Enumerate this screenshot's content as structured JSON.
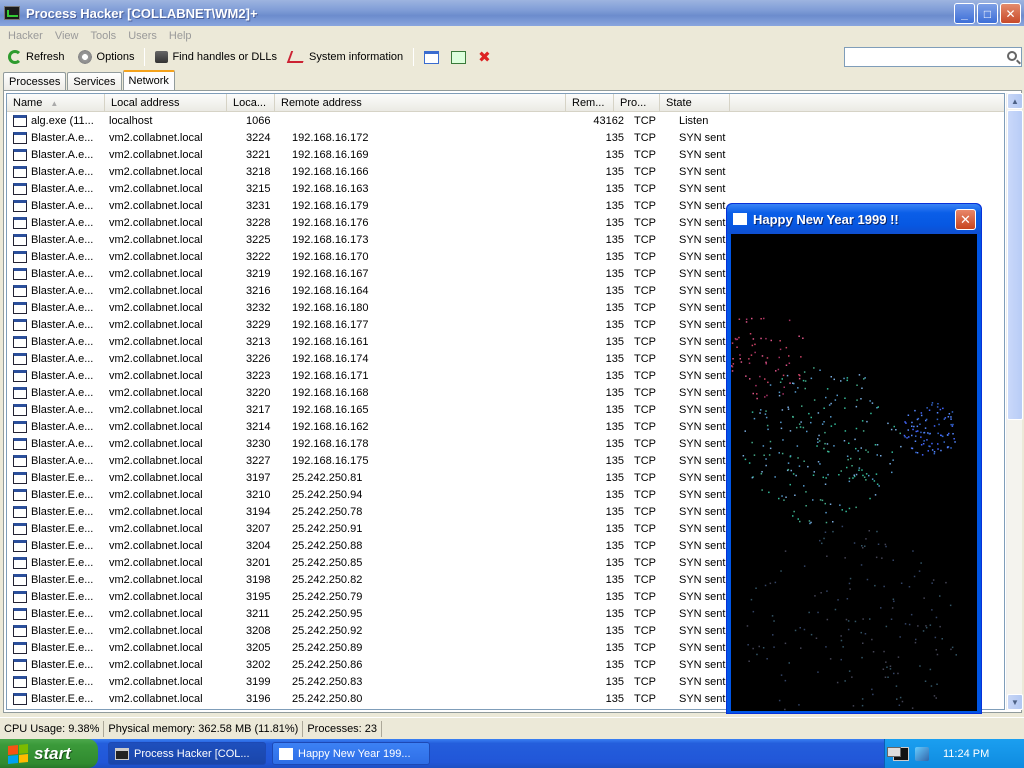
{
  "window": {
    "title": "Process Hacker [COLLABNET\\WM2]+"
  },
  "menu": [
    "Hacker",
    "View",
    "Tools",
    "Users",
    "Help"
  ],
  "toolbar": {
    "refresh": "Refresh",
    "options": "Options",
    "find_handles": "Find handles or DLLs",
    "system_information": "System information"
  },
  "search": {
    "placeholder": ""
  },
  "tabs": [
    "Processes",
    "Services",
    "Network"
  ],
  "active_tab": "Network",
  "columns": [
    "Name",
    "Local address",
    "Loca...",
    "Remote address",
    "Rem...",
    "Pro...",
    "State"
  ],
  "rows": [
    [
      "alg.exe (11...",
      "localhost",
      "1066",
      "",
      "43162",
      "TCP",
      "Listen"
    ],
    [
      "Blaster.A.e...",
      "vm2.collabnet.local",
      "3224",
      "192.168.16.172",
      "135",
      "TCP",
      "SYN sent"
    ],
    [
      "Blaster.A.e...",
      "vm2.collabnet.local",
      "3221",
      "192.168.16.169",
      "135",
      "TCP",
      "SYN sent"
    ],
    [
      "Blaster.A.e...",
      "vm2.collabnet.local",
      "3218",
      "192.168.16.166",
      "135",
      "TCP",
      "SYN sent"
    ],
    [
      "Blaster.A.e...",
      "vm2.collabnet.local",
      "3215",
      "192.168.16.163",
      "135",
      "TCP",
      "SYN sent"
    ],
    [
      "Blaster.A.e...",
      "vm2.collabnet.local",
      "3231",
      "192.168.16.179",
      "135",
      "TCP",
      "SYN sent"
    ],
    [
      "Blaster.A.e...",
      "vm2.collabnet.local",
      "3228",
      "192.168.16.176",
      "135",
      "TCP",
      "SYN sent"
    ],
    [
      "Blaster.A.e...",
      "vm2.collabnet.local",
      "3225",
      "192.168.16.173",
      "135",
      "TCP",
      "SYN sent"
    ],
    [
      "Blaster.A.e...",
      "vm2.collabnet.local",
      "3222",
      "192.168.16.170",
      "135",
      "TCP",
      "SYN sent"
    ],
    [
      "Blaster.A.e...",
      "vm2.collabnet.local",
      "3219",
      "192.168.16.167",
      "135",
      "TCP",
      "SYN sent"
    ],
    [
      "Blaster.A.e...",
      "vm2.collabnet.local",
      "3216",
      "192.168.16.164",
      "135",
      "TCP",
      "SYN sent"
    ],
    [
      "Blaster.A.e...",
      "vm2.collabnet.local",
      "3232",
      "192.168.16.180",
      "135",
      "TCP",
      "SYN sent"
    ],
    [
      "Blaster.A.e...",
      "vm2.collabnet.local",
      "3229",
      "192.168.16.177",
      "135",
      "TCP",
      "SYN sent"
    ],
    [
      "Blaster.A.e...",
      "vm2.collabnet.local",
      "3213",
      "192.168.16.161",
      "135",
      "TCP",
      "SYN sent"
    ],
    [
      "Blaster.A.e...",
      "vm2.collabnet.local",
      "3226",
      "192.168.16.174",
      "135",
      "TCP",
      "SYN sent"
    ],
    [
      "Blaster.A.e...",
      "vm2.collabnet.local",
      "3223",
      "192.168.16.171",
      "135",
      "TCP",
      "SYN sent"
    ],
    [
      "Blaster.A.e...",
      "vm2.collabnet.local",
      "3220",
      "192.168.16.168",
      "135",
      "TCP",
      "SYN sent"
    ],
    [
      "Blaster.A.e...",
      "vm2.collabnet.local",
      "3217",
      "192.168.16.165",
      "135",
      "TCP",
      "SYN sent"
    ],
    [
      "Blaster.A.e...",
      "vm2.collabnet.local",
      "3214",
      "192.168.16.162",
      "135",
      "TCP",
      "SYN sent"
    ],
    [
      "Blaster.A.e...",
      "vm2.collabnet.local",
      "3230",
      "192.168.16.178",
      "135",
      "TCP",
      "SYN sent"
    ],
    [
      "Blaster.A.e...",
      "vm2.collabnet.local",
      "3227",
      "192.168.16.175",
      "135",
      "TCP",
      "SYN sent"
    ],
    [
      "Blaster.E.e...",
      "vm2.collabnet.local",
      "3197",
      "25.242.250.81",
      "135",
      "TCP",
      "SYN sent"
    ],
    [
      "Blaster.E.e...",
      "vm2.collabnet.local",
      "3210",
      "25.242.250.94",
      "135",
      "TCP",
      "SYN sent"
    ],
    [
      "Blaster.E.e...",
      "vm2.collabnet.local",
      "3194",
      "25.242.250.78",
      "135",
      "TCP",
      "SYN sent"
    ],
    [
      "Blaster.E.e...",
      "vm2.collabnet.local",
      "3207",
      "25.242.250.91",
      "135",
      "TCP",
      "SYN sent"
    ],
    [
      "Blaster.E.e...",
      "vm2.collabnet.local",
      "3204",
      "25.242.250.88",
      "135",
      "TCP",
      "SYN sent"
    ],
    [
      "Blaster.E.e...",
      "vm2.collabnet.local",
      "3201",
      "25.242.250.85",
      "135",
      "TCP",
      "SYN sent"
    ],
    [
      "Blaster.E.e...",
      "vm2.collabnet.local",
      "3198",
      "25.242.250.82",
      "135",
      "TCP",
      "SYN sent"
    ],
    [
      "Blaster.E.e...",
      "vm2.collabnet.local",
      "3195",
      "25.242.250.79",
      "135",
      "TCP",
      "SYN sent"
    ],
    [
      "Blaster.E.e...",
      "vm2.collabnet.local",
      "3211",
      "25.242.250.95",
      "135",
      "TCP",
      "SYN sent"
    ],
    [
      "Blaster.E.e...",
      "vm2.collabnet.local",
      "3208",
      "25.242.250.92",
      "135",
      "TCP",
      "SYN sent"
    ],
    [
      "Blaster.E.e...",
      "vm2.collabnet.local",
      "3205",
      "25.242.250.89",
      "135",
      "TCP",
      "SYN sent"
    ],
    [
      "Blaster.E.e...",
      "vm2.collabnet.local",
      "3202",
      "25.242.250.86",
      "135",
      "TCP",
      "SYN sent"
    ],
    [
      "Blaster.E.e...",
      "vm2.collabnet.local",
      "3199",
      "25.242.250.83",
      "135",
      "TCP",
      "SYN sent"
    ],
    [
      "Blaster.E.e...",
      "vm2.collabnet.local",
      "3196",
      "25.242.250.80",
      "135",
      "TCP",
      "SYN sent"
    ]
  ],
  "status": {
    "cpu": "CPU Usage: 9.38%",
    "memory": "Physical memory: 362.58 MB (11.81%)",
    "processes": "Processes: 23"
  },
  "popup": {
    "title": "Happy New Year 1999 !!"
  },
  "taskbar": {
    "start": "start",
    "tasks": [
      "Process Hacker [COL...",
      "Happy New Year 199..."
    ],
    "clock": "11:24 PM"
  }
}
